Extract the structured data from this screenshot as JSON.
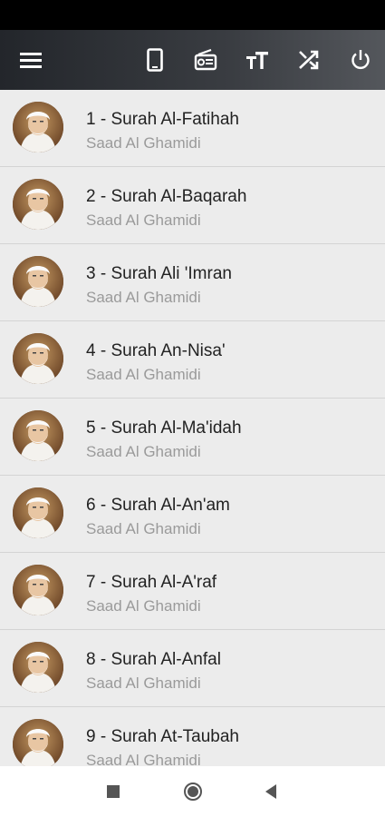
{
  "app_bar": {
    "icons": [
      "menu-icon",
      "phone-icon",
      "radio-icon",
      "text-size-icon",
      "shuffle-icon",
      "power-icon"
    ]
  },
  "surahs": [
    {
      "title": "1 - Surah Al-Fatihah",
      "reciter": "Saad Al Ghamidi"
    },
    {
      "title": "2 - Surah Al-Baqarah",
      "reciter": "Saad Al Ghamidi"
    },
    {
      "title": "3 - Surah Ali 'Imran",
      "reciter": "Saad Al Ghamidi"
    },
    {
      "title": "4 - Surah An-Nisa'",
      "reciter": "Saad Al Ghamidi"
    },
    {
      "title": "5 - Surah Al-Ma'idah",
      "reciter": "Saad Al Ghamidi"
    },
    {
      "title": "6 - Surah Al-An'am",
      "reciter": "Saad Al Ghamidi"
    },
    {
      "title": "7 - Surah Al-A'raf",
      "reciter": "Saad Al Ghamidi"
    },
    {
      "title": "8 - Surah Al-Anfal",
      "reciter": "Saad Al Ghamidi"
    },
    {
      "title": "9 - Surah At-Taubah",
      "reciter": "Saad Al Ghamidi"
    }
  ],
  "nav_bar": {
    "icons": [
      "recents-icon",
      "home-icon",
      "back-icon"
    ]
  }
}
